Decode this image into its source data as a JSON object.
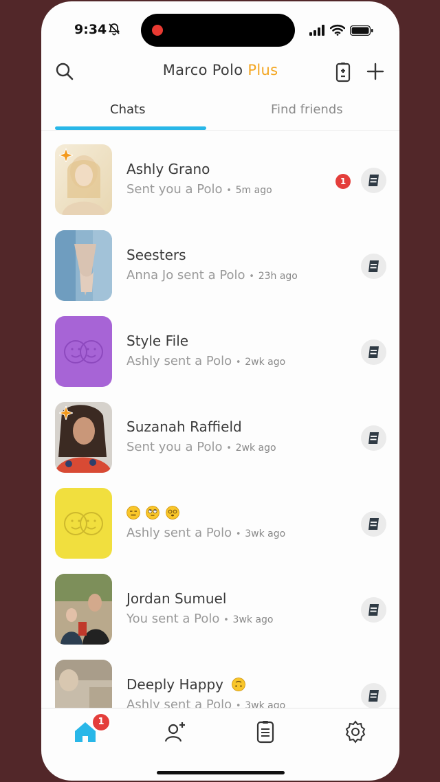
{
  "status_bar": {
    "time": "9:34"
  },
  "header": {
    "title_main": "Marco Polo",
    "title_accent": "Plus"
  },
  "tabs": [
    {
      "label": "Chats",
      "active": true
    },
    {
      "label": "Find friends",
      "active": false
    }
  ],
  "chats": [
    {
      "name": "Ashly Grano",
      "status": "Sent you a Polo",
      "ago": "5m ago",
      "unread": "1",
      "avatar": "photo-beach",
      "star": true
    },
    {
      "name": "Seesters",
      "status": "Anna Jo sent a Polo",
      "ago": "23h ago",
      "avatar": "photo-hands",
      "star": false
    },
    {
      "name": "Style File",
      "status": "Ashly sent a Polo",
      "ago": "2wk ago",
      "avatar": "group-purple",
      "star": false
    },
    {
      "name": "Suzanah Raffield",
      "status": "Sent you a Polo",
      "ago": "2wk ago",
      "avatar": "photo-selfie",
      "star": true
    },
    {
      "name": "",
      "status": "Ashly sent a Polo",
      "ago": "3wk ago",
      "avatar": "group-yellow",
      "star": false,
      "emoji_name": [
        "expressionless-face",
        "rolling-eyes-face",
        "dizzy-face"
      ]
    },
    {
      "name": "Jordan Sumuel",
      "status": "You sent a Polo",
      "ago": "3wk ago",
      "avatar": "photo-family",
      "star": false
    },
    {
      "name": "Deeply Happy",
      "status": "Ashly sent a Polo",
      "ago": "3wk ago",
      "avatar": "photo-blur",
      "star": false,
      "emoji_suffix": "upside-down-face"
    }
  ],
  "nav": {
    "home_badge": "1"
  },
  "colors": {
    "accent": "#29b7e8",
    "plus": "#f3a51f",
    "badge": "#e43e3b",
    "purple": "#a764d6",
    "yellow": "#f1df3e"
  }
}
